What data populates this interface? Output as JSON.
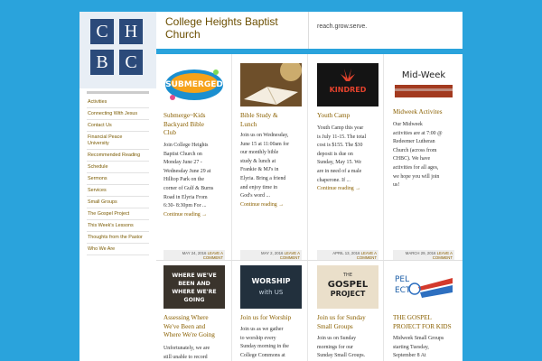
{
  "site": {
    "logo_letters": [
      "C",
      "H",
      "B",
      "C"
    ],
    "title_line1": "College Heights Baptist",
    "title_line2": "Church",
    "tagline": "reach.grow.serve."
  },
  "sidebar": {
    "items": [
      "Activities",
      "Connecting With Jesus",
      "Contact Us",
      "Financial Peace",
      "University",
      "Recommended Reading",
      "Schedule",
      "Sermons",
      "Services",
      "Small Groups",
      "The Gospel Project",
      "This Week's Lessons",
      "Thoughts from the Pastor",
      "Who We Are"
    ]
  },
  "posts": [
    {
      "thumb_text": "SUBMERGED",
      "title_lines": [
        "Submerge~Kids",
        "Backyard Bible",
        "Club"
      ],
      "excerpt_lines": [
        "Join College Heights",
        "Baptist Church on",
        "Monday June 27 -",
        "Wednesday June 29 at",
        "Hilltop Park on the",
        "corner of Gulf & Burns",
        "Road in Elyria From",
        "6:30- 8:30pm For ..."
      ],
      "more": "Continue reading →",
      "date": "MAY 24, 2016",
      "leave_comment_1": "LEAVE A",
      "leave_comment_2": "COMMENT"
    },
    {
      "thumb_text": "",
      "title_lines": [
        "Bible Study &",
        "Lunch"
      ],
      "excerpt_lines": [
        "Join us on Wednesday,",
        "June 15 at 11:00am for",
        "our monthly bible",
        "study & lunch at",
        "Frankie & MJ's in",
        "Elyria.  Bring a friend",
        "and enjoy time in",
        "God's word ..."
      ],
      "more": "Continue reading →",
      "date": "MAY 2, 2016",
      "leave_comment_1": "LEAVE A",
      "leave_comment_2": "COMMENT"
    },
    {
      "thumb_text": "KINDRED",
      "title_lines": [
        "Youth Camp"
      ],
      "excerpt_lines": [
        "Youth Camp this year",
        "is July 11-15. The total",
        "cost is $155. The $30",
        "deposit is due on",
        "Sunday, May 15. We",
        "are in need of a male",
        "chaperone. If ..."
      ],
      "more": "Continue reading →",
      "date": "APRIL 13, 2016",
      "leave_comment_1": "LEAVE A",
      "leave_comment_2": "COMMENT"
    },
    {
      "thumb_text": "Mid-Week",
      "title_lines": [
        "Midweek Activites"
      ],
      "excerpt_lines": [
        "   Our Midweek",
        "activities are at 7:00 @",
        "Redeemer Lutheran",
        "Church (across from",
        "CHBC).  We have",
        "activities for all ages,",
        "we hope you will join",
        "us!"
      ],
      "more": "",
      "date": "MARCH 29, 2016",
      "leave_comment_1": "LEAVE A",
      "leave_comment_2": "COMMENT"
    },
    {
      "thumb_text_1": "WHERE WE'VE",
      "thumb_text_2": "BEEN AND",
      "thumb_text_3": "WHERE WE'RE",
      "thumb_text_4": "GOING",
      "title_lines": [
        "Assessing Where",
        "We've Been and",
        "Where We're Going"
      ],
      "excerpt_lines": [
        "Unfortunately, we are",
        "still unable to record"
      ]
    },
    {
      "thumb_text_1": "WORSHIP",
      "thumb_text_2": "with US",
      "title_lines": [
        "Join us for Worship"
      ],
      "excerpt_lines": [
        "   Join us as we gather",
        "to worship every",
        "Sunday morning in the",
        "College Commons at"
      ]
    },
    {
      "thumb_text_1": "THE",
      "thumb_text_2": "GOSPEL",
      "thumb_text_3": "PROJECT",
      "title_lines": [
        "Join us for Sunday",
        "Small Groups"
      ],
      "excerpt_lines": [
        "   Join us on Sunday",
        "mornings for our",
        "Sunday Small Groups."
      ]
    },
    {
      "thumb_text_1": "PEL",
      "thumb_text_2": "ECT",
      "title_lines": [
        "THE GOSPEL",
        "PROJECT FOR KIDS"
      ],
      "excerpt_lines": [
        "Midweek Small Groups",
        "starting Tuesday,",
        "September 8 At"
      ]
    }
  ]
}
